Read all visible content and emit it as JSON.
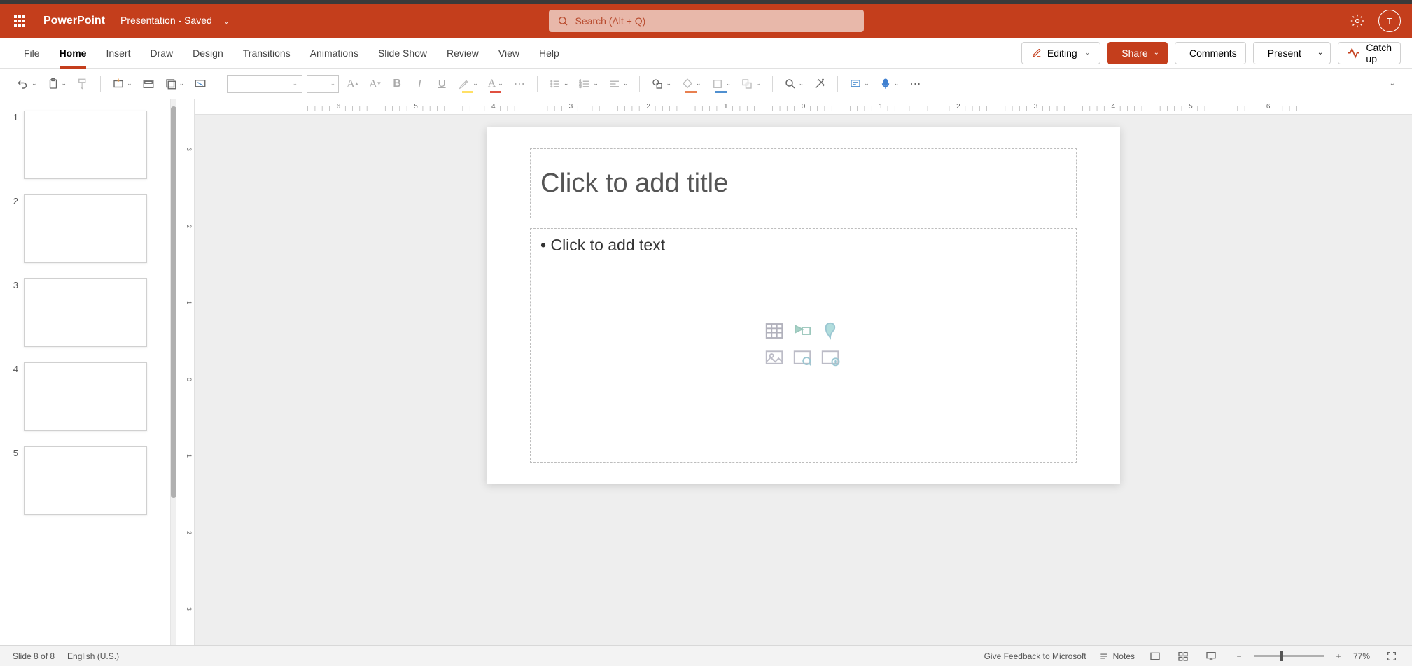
{
  "app": {
    "name": "PowerPoint",
    "docTitle": "Presentation",
    "docStatus": " - Saved",
    "avatar": "T"
  },
  "search": {
    "placeholder": "Search (Alt + Q)"
  },
  "tabs": {
    "file": "File",
    "home": "Home",
    "insert": "Insert",
    "draw": "Draw",
    "design": "Design",
    "transitions": "Transitions",
    "animations": "Animations",
    "slideshow": "Slide Show",
    "review": "Review",
    "view": "View",
    "help": "Help"
  },
  "ribbonRight": {
    "editing": "Editing",
    "share": "Share",
    "comments": "Comments",
    "present": "Present",
    "catchup": "Catch up"
  },
  "slide": {
    "titlePlaceholder": "Click to add title",
    "contentPlaceholder": "Click to add text"
  },
  "thumbnails": {
    "count": 5,
    "numbers": [
      "1",
      "2",
      "3",
      "4",
      "5"
    ]
  },
  "rulerH": [
    "6",
    "5",
    "4",
    "3",
    "2",
    "1",
    "0",
    "1",
    "2",
    "3",
    "4",
    "5",
    "6"
  ],
  "rulerV": [
    "3",
    "2",
    "1",
    "0",
    "1",
    "2",
    "3"
  ],
  "status": {
    "slideInfo": "Slide 8 of 8",
    "language": "English (U.S.)",
    "feedback": "Give Feedback to Microsoft",
    "notes": "Notes",
    "zoom": "77%"
  }
}
